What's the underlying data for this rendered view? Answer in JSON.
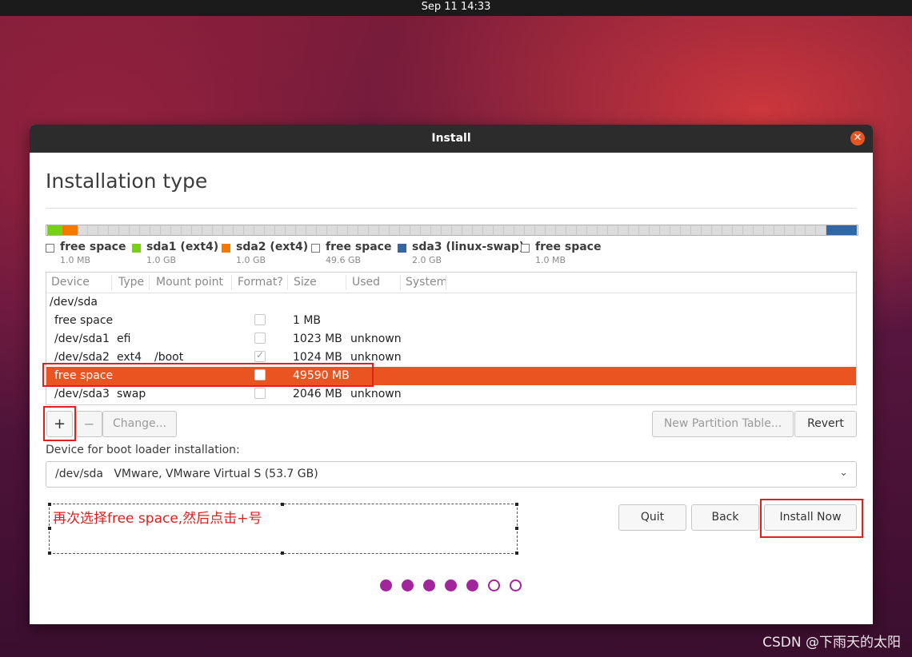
{
  "topbar": {
    "datetime": "Sep 11  14:33"
  },
  "window": {
    "title": "Install",
    "close_glyph": "✕"
  },
  "page": {
    "heading": "Installation type"
  },
  "partition_bar": {
    "segments": [
      {
        "name": "free space",
        "mb": 1,
        "color": "#ffffff"
      },
      {
        "name": "sda1 (ext4)",
        "mb": 1023,
        "color": "#73d216"
      },
      {
        "name": "sda2 (ext4)",
        "mb": 1024,
        "color": "#f57900"
      },
      {
        "name": "free space",
        "mb": 49590,
        "color": "#dcdcdc"
      },
      {
        "name": "sda3 (linux-swap)",
        "mb": 2046,
        "color": "#3465a4"
      },
      {
        "name": "free space",
        "mb": 1,
        "color": "#ffffff"
      }
    ]
  },
  "legend": [
    {
      "name": "free space",
      "size": "1.0 MB",
      "color": "#ffffff"
    },
    {
      "name": "sda1 (ext4)",
      "size": "1.0 GB",
      "color": "#73d216"
    },
    {
      "name": "sda2 (ext4)",
      "size": "1.0 GB",
      "color": "#f57900"
    },
    {
      "name": "free space",
      "size": "49.6 GB",
      "color": "#ffffff"
    },
    {
      "name": "sda3 (linux-swap)",
      "size": "2.0 GB",
      "color": "#3465a4"
    },
    {
      "name": "free space",
      "size": "1.0 MB",
      "color": "#ffffff"
    }
  ],
  "table": {
    "columns": [
      "Device",
      "Type",
      "Mount point",
      "Format?",
      "Size",
      "Used",
      "System"
    ],
    "rows": [
      {
        "device": "/dev/sda",
        "type": "",
        "mount": "",
        "format": null,
        "size": "",
        "used": "",
        "selected": false
      },
      {
        "device": "free space",
        "type": "",
        "mount": "",
        "format": false,
        "size": "1 MB",
        "used": "",
        "selected": false
      },
      {
        "device": "/dev/sda1",
        "type": "efi",
        "mount": "",
        "format": false,
        "size": "1023 MB",
        "used": "unknown",
        "selected": false
      },
      {
        "device": "/dev/sda2",
        "type": "ext4",
        "mount": "/boot",
        "format": true,
        "size": "1024 MB",
        "used": "unknown",
        "selected": false
      },
      {
        "device": "free space",
        "type": "",
        "mount": "",
        "format": false,
        "size": "49590 MB",
        "used": "",
        "selected": true
      },
      {
        "device": "/dev/sda3",
        "type": "swap",
        "mount": "",
        "format": false,
        "size": "2046 MB",
        "used": "unknown",
        "selected": false
      }
    ]
  },
  "buttons": {
    "add": "+",
    "remove": "−",
    "change": "Change...",
    "new_table": "New Partition Table...",
    "revert": "Revert",
    "quit": "Quit",
    "back": "Back",
    "install": "Install Now"
  },
  "bootloader": {
    "label": "Device for boot loader installation:",
    "selected": "/dev/sda   VMware, VMware Virtual S (53.7 GB)",
    "chevron": "⌄"
  },
  "annotation": {
    "text": "再次选择free space,然后点击+号"
  },
  "progress": {
    "total": 7,
    "completed": 5,
    "color": "#a3259b"
  },
  "watermark": "CSDN @下雨天的太阳"
}
